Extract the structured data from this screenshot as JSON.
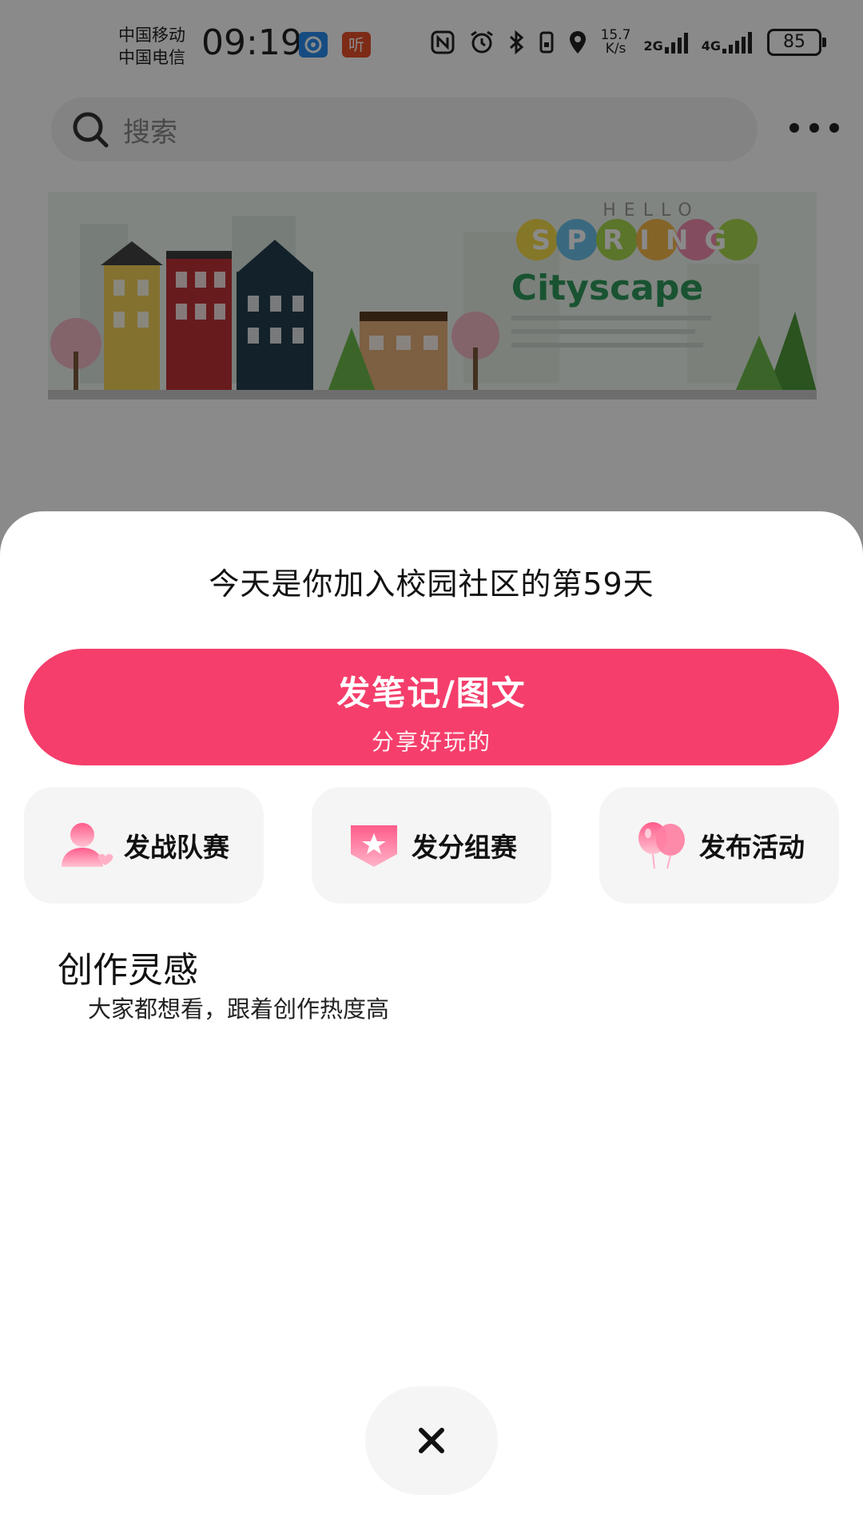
{
  "status_bar": {
    "carrier_1": "中国移动",
    "carrier_2": "中国电信",
    "time": "09:19",
    "app_badge_listen": "听",
    "net_speed_value": "15.7",
    "net_speed_unit": "K/s",
    "network_1": "2G",
    "network_2": "4G",
    "battery": "85"
  },
  "search": {
    "placeholder": "搜索"
  },
  "banner": {
    "line1": "HELLO",
    "line2": "SPRING",
    "line3": "Cityscape"
  },
  "sheet": {
    "join_days_text": "今天是你加入校园社区的第59天",
    "primary_action": {
      "title": "发笔记/图文",
      "subtitle": "分享好玩的"
    },
    "actions": [
      {
        "label": "发战队赛",
        "icon": "team-person-icon"
      },
      {
        "label": "发分组赛",
        "icon": "star-badge-icon"
      },
      {
        "label": "发布活动",
        "icon": "balloons-icon"
      }
    ],
    "inspiration": {
      "title": "创作灵感",
      "subtitle": "大家都想看，跟着创作热度高"
    },
    "close_icon": "close-icon"
  },
  "colors": {
    "primary": "#f53e6b",
    "icon_pink": "#ff5c8a",
    "card_bg": "#f5f5f5"
  }
}
